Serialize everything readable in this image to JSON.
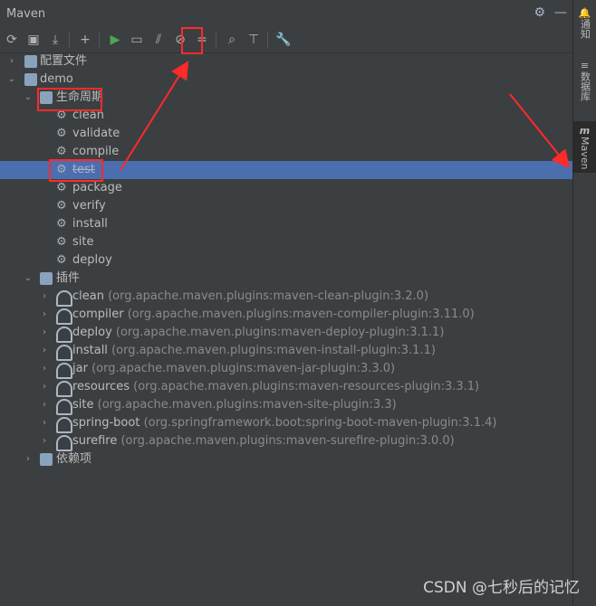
{
  "window": {
    "title": "Maven"
  },
  "side_tabs": [
    {
      "icon": "bell-icon",
      "label": "通知"
    },
    {
      "icon": "database-icon",
      "label": "数据库"
    },
    {
      "icon": "maven-icon",
      "label": "Maven"
    }
  ],
  "tree": {
    "config": "配置文件",
    "project": "demo",
    "lifecycle": {
      "label": "生命周期",
      "items": [
        "clean",
        "validate",
        "compile",
        "test",
        "package",
        "verify",
        "install",
        "site",
        "deploy"
      ],
      "selected": "test"
    },
    "plugins": {
      "label": "插件",
      "items": [
        {
          "name": "clean",
          "coord": "(org.apache.maven.plugins:maven-clean-plugin:3.2.0)"
        },
        {
          "name": "compiler",
          "coord": "(org.apache.maven.plugins:maven-compiler-plugin:3.11.0)"
        },
        {
          "name": "deploy",
          "coord": "(org.apache.maven.plugins:maven-deploy-plugin:3.1.1)"
        },
        {
          "name": "install",
          "coord": "(org.apache.maven.plugins:maven-install-plugin:3.1.1)"
        },
        {
          "name": "jar",
          "coord": "(org.apache.maven.plugins:maven-jar-plugin:3.3.0)"
        },
        {
          "name": "resources",
          "coord": "(org.apache.maven.plugins:maven-resources-plugin:3.3.1)"
        },
        {
          "name": "site",
          "coord": "(org.apache.maven.plugins:maven-site-plugin:3.3)"
        },
        {
          "name": "spring-boot",
          "coord": "(org.springframework.boot:spring-boot-maven-plugin:3.1.4)"
        },
        {
          "name": "surefire",
          "coord": "(org.apache.maven.plugins:maven-surefire-plugin:3.0.0)"
        }
      ]
    },
    "dependencies": "依赖项"
  },
  "watermark": "CSDN @七秒后的记忆"
}
